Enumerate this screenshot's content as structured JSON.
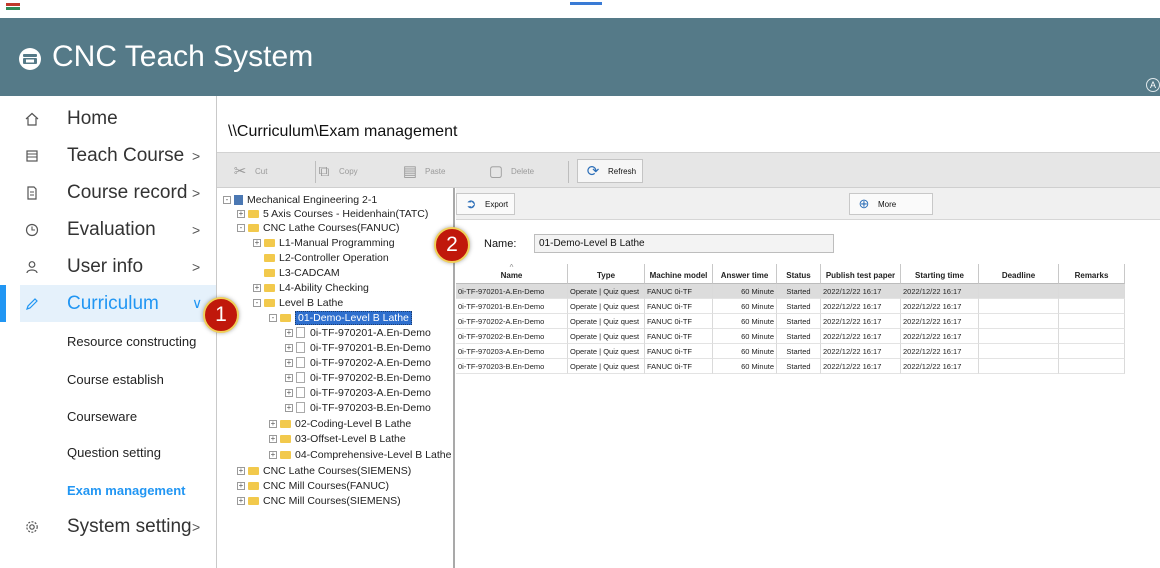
{
  "app": {
    "title": "CNC Teach System",
    "corner_label": "A"
  },
  "sidebar": {
    "items": [
      {
        "label": "Home",
        "chevron": ""
      },
      {
        "label": "Teach Course",
        "chevron": ">"
      },
      {
        "label": "Course record",
        "chevron": ">"
      },
      {
        "label": "Evaluation",
        "chevron": ">"
      },
      {
        "label": "User info",
        "chevron": ">"
      },
      {
        "label": "Curriculum",
        "chevron": "∨"
      },
      {
        "label": "System setting",
        "chevron": ">"
      }
    ],
    "subitems": [
      {
        "label": "Resource constructing"
      },
      {
        "label": "Course establish"
      },
      {
        "label": "Courseware"
      },
      {
        "label": "Question setting"
      },
      {
        "label": "Exam management"
      }
    ]
  },
  "breadcrumb": "\\\\Curriculum\\Exam management",
  "toolbar": {
    "cut": "Cut",
    "copy": "Copy",
    "paste": "Paste",
    "delete": "Delete",
    "refresh": "Refresh"
  },
  "tree": [
    {
      "label": "Mechanical Engineering 2-1"
    },
    {
      "label": "5 Axis Courses - Heidenhain(TATC)"
    },
    {
      "label": "CNC Lathe Courses(FANUC)"
    },
    {
      "label": "L1-Manual Programming"
    },
    {
      "label": "L2-Controller Operation"
    },
    {
      "label": "L3-CADCAM"
    },
    {
      "label": "L4-Ability Checking"
    },
    {
      "label": "Level B Lathe"
    },
    {
      "label": "01-Demo-Level B Lathe"
    },
    {
      "label": "0i-TF-970201-A.En-Demo"
    },
    {
      "label": "0i-TF-970201-B.En-Demo"
    },
    {
      "label": "0i-TF-970202-A.En-Demo"
    },
    {
      "label": "0i-TF-970202-B.En-Demo"
    },
    {
      "label": "0i-TF-970203-A.En-Demo"
    },
    {
      "label": "0i-TF-970203-B.En-Demo"
    },
    {
      "label": "02-Coding-Level B Lathe"
    },
    {
      "label": "03-Offset-Level B Lathe"
    },
    {
      "label": "04-Comprehensive-Level B Lathe"
    },
    {
      "label": "CNC Lathe Courses(SIEMENS)"
    },
    {
      "label": "CNC Mill Courses(FANUC)"
    },
    {
      "label": "CNC Mill Courses(SIEMENS)"
    }
  ],
  "panel": {
    "export": "Export",
    "more": "More",
    "name_label": "Name:",
    "name_value": "01-Demo-Level B Lathe"
  },
  "table": {
    "sort_glyph": "^",
    "headers": [
      "Name",
      "Type",
      "Machine model",
      "Answer time",
      "Status",
      "Publish test paper",
      "Starting time",
      "Deadline",
      "Remarks"
    ],
    "rows": [
      [
        "0i-TF-970201-A.En-Demo",
        "Operate | Quiz quest",
        "FANUC 0i-TF",
        "60 Minute",
        "Started",
        "2022/12/22 16:17",
        "2022/12/22 16:17",
        "",
        ""
      ],
      [
        "0i-TF-970201-B.En-Demo",
        "Operate | Quiz quest",
        "FANUC 0i-TF",
        "60 Minute",
        "Started",
        "2022/12/22 16:17",
        "2022/12/22 16:17",
        "",
        ""
      ],
      [
        "0i-TF-970202-A.En-Demo",
        "Operate | Quiz quest",
        "FANUC 0i-TF",
        "60 Minute",
        "Started",
        "2022/12/22 16:17",
        "2022/12/22 16:17",
        "",
        ""
      ],
      [
        "0i-TF-970202-B.En-Demo",
        "Operate | Quiz quest",
        "FANUC 0i-TF",
        "60 Minute",
        "Started",
        "2022/12/22 16:17",
        "2022/12/22 16:17",
        "",
        ""
      ],
      [
        "0i-TF-970203-A.En-Demo",
        "Operate | Quiz quest",
        "FANUC 0i-TF",
        "60 Minute",
        "Started",
        "2022/12/22 16:17",
        "2022/12/22 16:17",
        "",
        ""
      ],
      [
        "0i-TF-970203-B.En-Demo",
        "Operate | Quiz quest",
        "FANUC 0i-TF",
        "60 Minute",
        "Started",
        "2022/12/22 16:17",
        "2022/12/22 16:17",
        "",
        ""
      ]
    ]
  },
  "badges": [
    "1",
    "2"
  ],
  "colors": {
    "header": "#557a88",
    "accent": "#2196f3",
    "badge": "#c0180b",
    "tree_selection": "#2e6fce"
  },
  "icons": {
    "nav": [
      "home-icon",
      "book-icon",
      "document-icon",
      "clock-icon",
      "user-icon",
      "pencil-icon",
      "gear-icon"
    ]
  }
}
